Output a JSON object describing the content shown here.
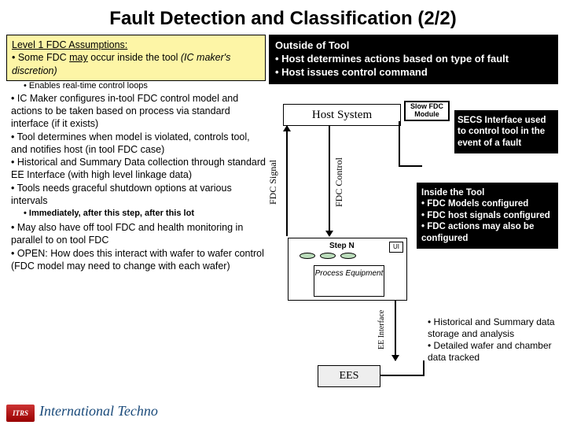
{
  "title": "Fault Detection and Classification (2/2)",
  "left": {
    "assumptions": {
      "heading": "Level 1 FDC Assumptions:",
      "line1_a": "• Some FDC ",
      "line1_u": "may",
      "line1_b": " occur inside the tool ",
      "line1_c": "(IC maker's discretion)",
      "realtime": "• Enables real-time control loops"
    },
    "bullets_a": "• IC Maker configures in-tool FDC control model and actions to be taken based on process via standard interface (if it exists)\n• Tool determines when model is violated, controls tool, and notifies host (in tool FDC case)\n• Historical and Summary Data collection through standard EE Interface (with high level linkage data)\n• Tools needs graceful shutdown options at various intervals",
    "immediately": "• Immediately, after this step, after this lot",
    "bullets_b": "• May also have off tool FDC and health monitoring in parallel to on tool FDC\n• OPEN: How does this interact with wafer to wafer control (FDC model may need to change with each wafer)"
  },
  "right": {
    "outside": "Outside of Tool\n• Host determines actions based on type of fault\n• Host issues control command",
    "host": "Host System",
    "slow": "Slow FDC Module",
    "secs": "SECS Interface used to control tool in the event of a fault",
    "inside": "Inside the Tool\n• FDC Models configured\n• FDC host signals configured\n• FDC actions may also be configured",
    "hist": "• Historical and Summary data storage and analysis\n• Detailed wafer and chamber data tracked",
    "signal": "FDC Signal",
    "control": "FDC Control",
    "eeif": "EE Interface",
    "step": "Step N",
    "ui": "UI",
    "proc": "Process Equipment",
    "ees": "EES"
  },
  "footer": {
    "logo": "ITRS",
    "text": "International Techno"
  }
}
